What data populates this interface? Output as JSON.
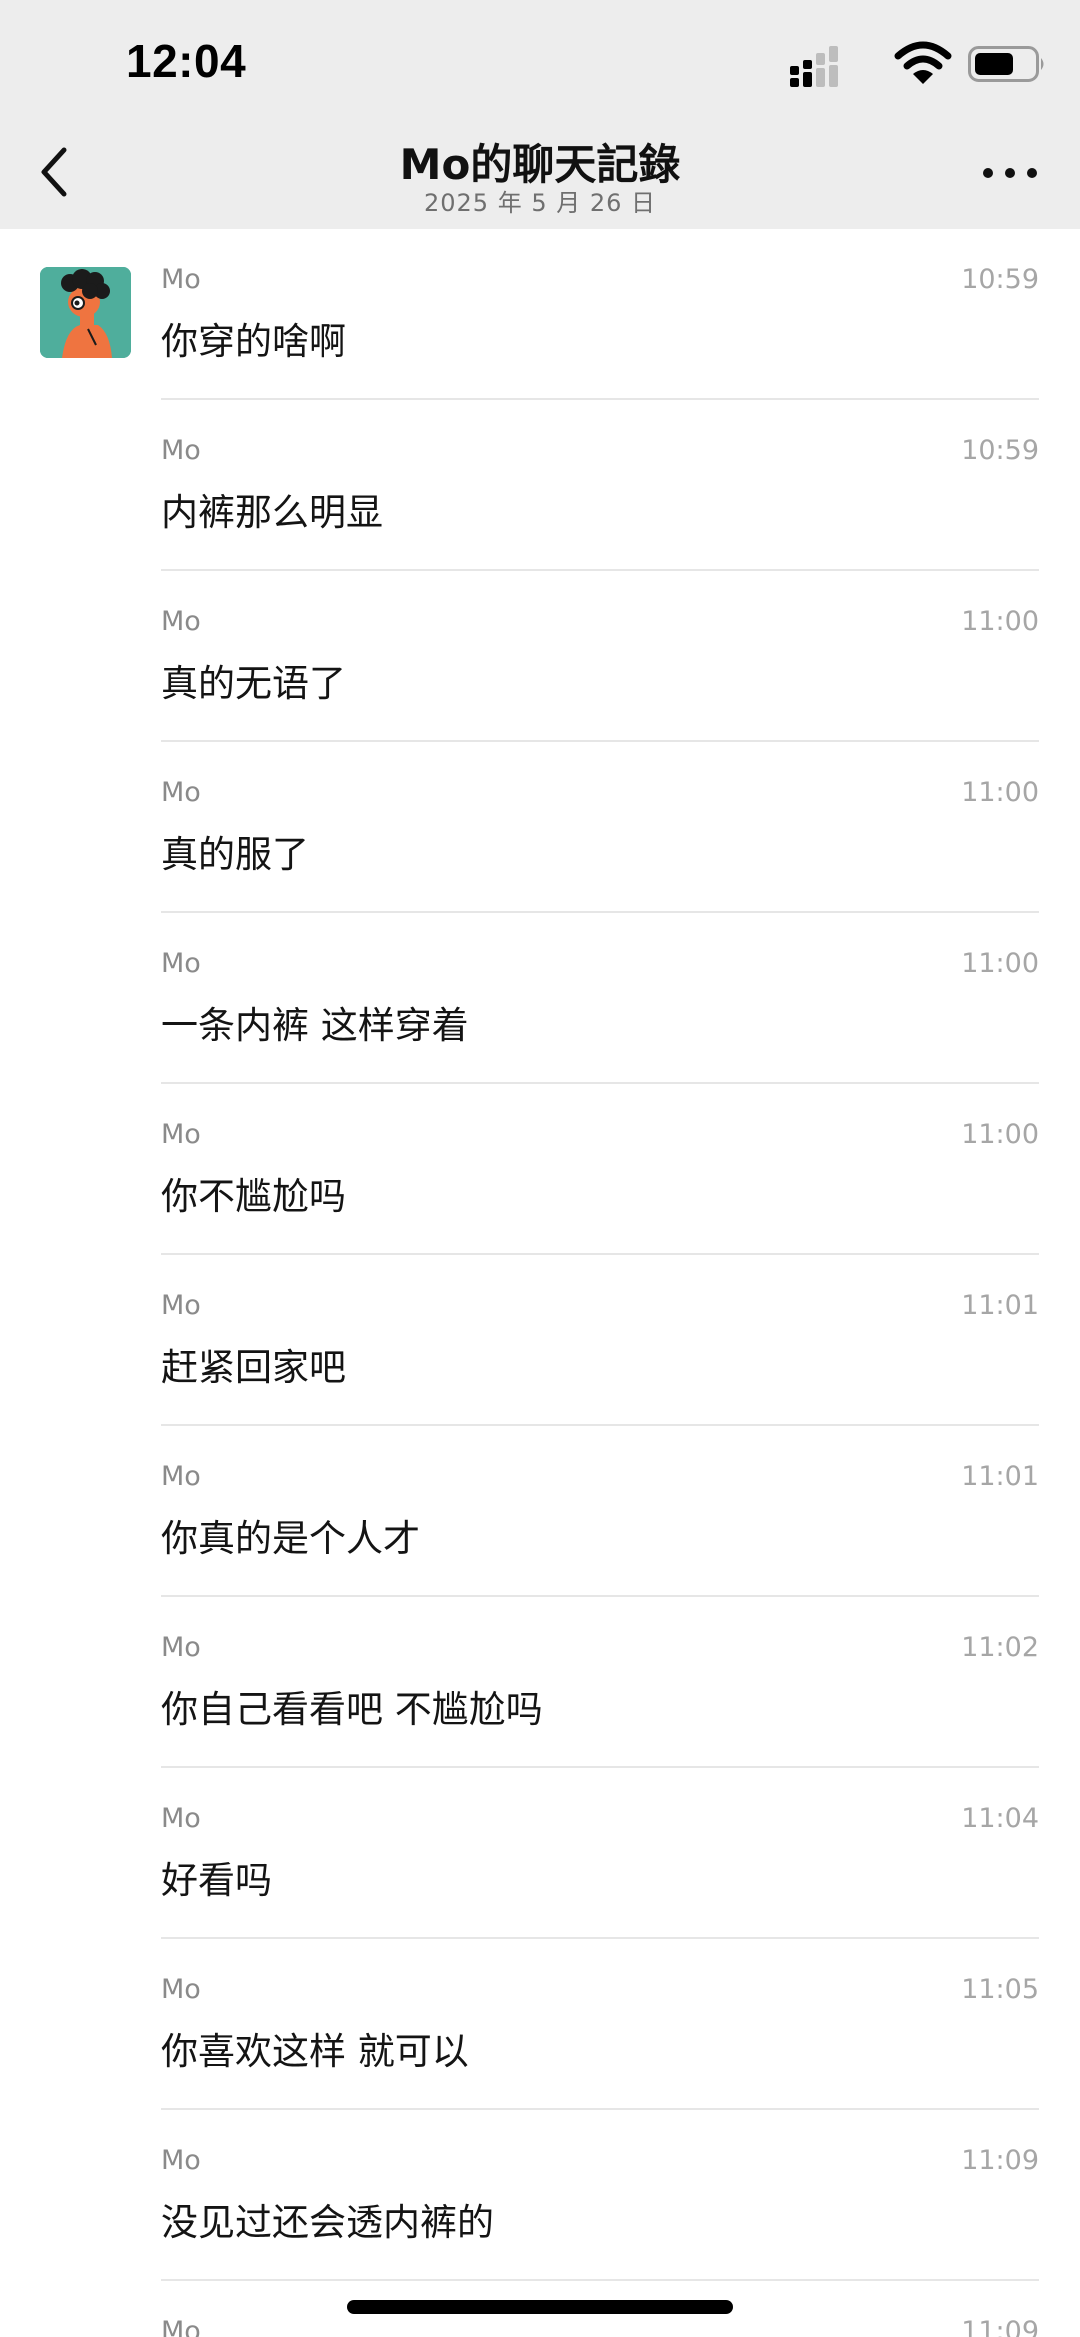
{
  "status_bar": {
    "time": "12:04",
    "signal_icon": "cellular-signal-icon",
    "wifi_icon": "wifi-icon",
    "battery_icon": "battery-icon"
  },
  "nav": {
    "title": "Mo的聊天記錄",
    "subtitle": "2025 年 5 月 26 日",
    "back_icon": "chevron-left-icon",
    "more_icon": "more-horizontal-icon"
  },
  "chat": {
    "sender": "Mo",
    "avatar_icon": "avatar-illustration",
    "messages": [
      {
        "sender": "Mo",
        "time": "10:59",
        "text": "你穿的啥啊"
      },
      {
        "sender": "Mo",
        "time": "10:59",
        "text": "内裤那么明显"
      },
      {
        "sender": "Mo",
        "time": "11:00",
        "text": "真的无语了"
      },
      {
        "sender": "Mo",
        "time": "11:00",
        "text": "真的服了"
      },
      {
        "sender": "Mo",
        "time": "11:00",
        "text": "一条内裤 这样穿着"
      },
      {
        "sender": "Mo",
        "time": "11:00",
        "text": "你不尴尬吗"
      },
      {
        "sender": "Mo",
        "time": "11:01",
        "text": "赶紧回家吧"
      },
      {
        "sender": "Mo",
        "time": "11:01",
        "text": "你真的是个人才"
      },
      {
        "sender": "Mo",
        "time": "11:02",
        "text": "你自己看看吧 不尴尬吗"
      },
      {
        "sender": "Mo",
        "time": "11:04",
        "text": "好看吗"
      },
      {
        "sender": "Mo",
        "time": "11:05",
        "text": "你喜欢这样 就可以"
      },
      {
        "sender": "Mo",
        "time": "11:09",
        "text": "没见过还会透内裤的"
      },
      {
        "sender": "Mo",
        "time": "11:09",
        "text": ""
      }
    ]
  },
  "colors": {
    "header_bg": "#ededed",
    "list_bg": "#ffffff",
    "divider": "#e6e6e6",
    "avatar_bg": "#4fae9c",
    "avatar_figure": "#ef7440"
  }
}
